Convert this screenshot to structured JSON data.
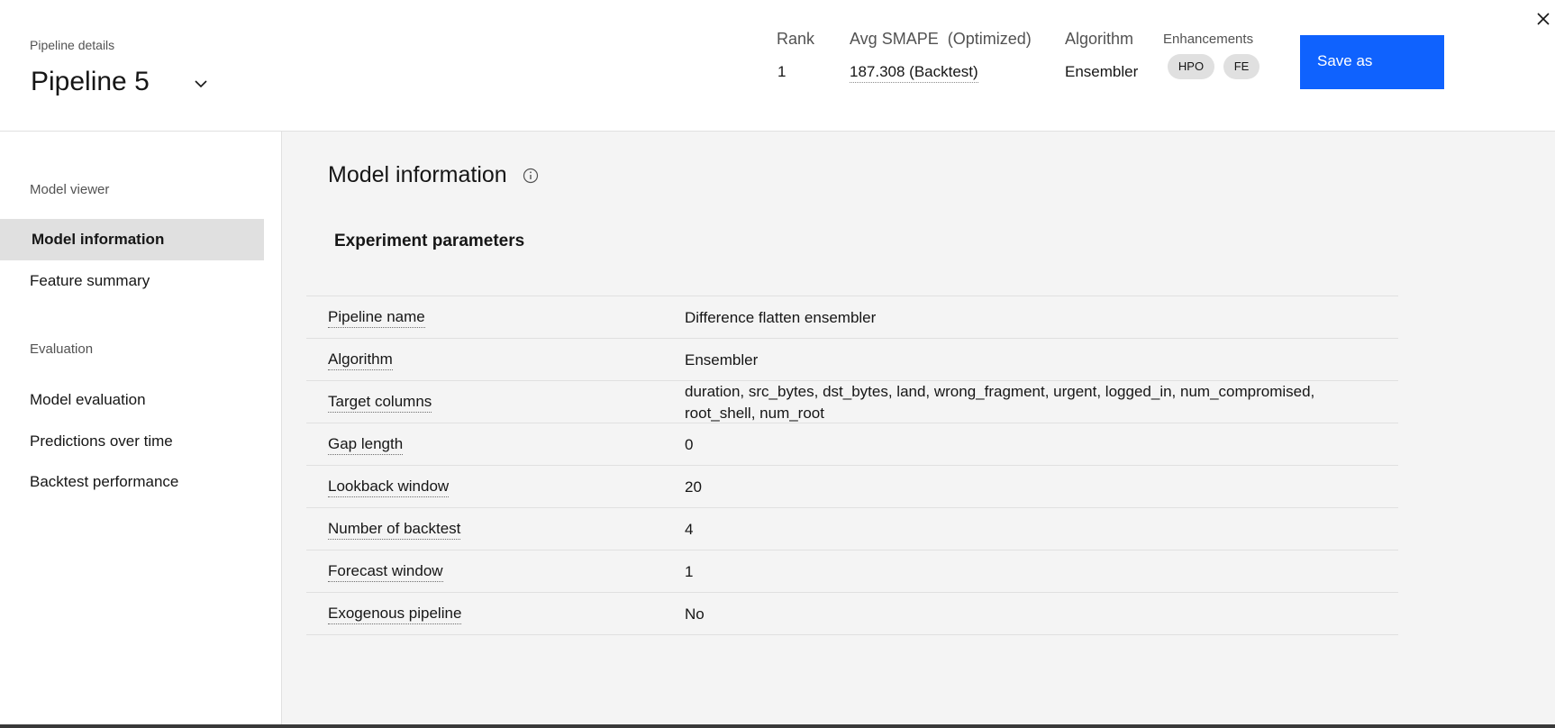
{
  "header": {
    "eyebrow": "Pipeline details",
    "pipeline_name": "Pipeline 5",
    "rank_label": "Rank",
    "rank_value": "1",
    "metric_label": "Avg SMAPE  (Optimized)",
    "metric_value": "187.308 (Backtest)",
    "algorithm_label": "Algorithm",
    "algorithm_value": "Ensembler",
    "enhancements_label": "Enhancements",
    "enhancements": [
      "HPO",
      "FE"
    ],
    "save_label": "Save as"
  },
  "sidebar": {
    "section_model": "Model viewer",
    "model_items": [
      "Model information",
      "Feature summary"
    ],
    "section_eval": "Evaluation",
    "eval_items": [
      "Model evaluation",
      "Predictions over time",
      "Backtest performance"
    ],
    "active_item": "Model information"
  },
  "main": {
    "title": "Model information",
    "section_title": "Experiment parameters",
    "parameters": [
      {
        "label": "Pipeline name",
        "value": "Difference flatten ensembler"
      },
      {
        "label": "Algorithm",
        "value": "Ensembler"
      },
      {
        "label": "Target columns",
        "value": "duration, src_bytes, dst_bytes, land, wrong_fragment, urgent, logged_in, num_compromised, root_shell, num_root"
      },
      {
        "label": "Gap length",
        "value": "0"
      },
      {
        "label": "Lookback window",
        "value": "20"
      },
      {
        "label": "Number of backtest",
        "value": "4"
      },
      {
        "label": "Forecast window",
        "value": "1"
      },
      {
        "label": "Exogenous pipeline",
        "value": "No"
      }
    ]
  },
  "icons": {
    "dropdown": "chevron-down-icon",
    "close": "close-icon",
    "info": "info-icon"
  },
  "colors": {
    "primary": "#0f62fe",
    "active_nav": "#e0e0e0",
    "content_bg": "#f4f4f4"
  }
}
